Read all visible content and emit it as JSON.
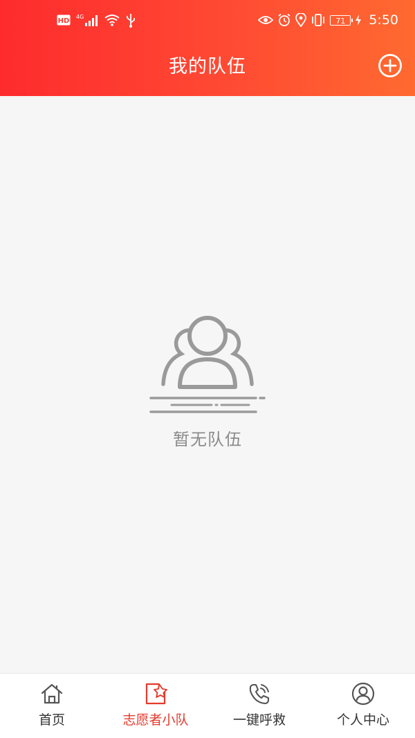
{
  "status_bar": {
    "network_badge": "HD",
    "network_type": "4G",
    "battery_level": "71",
    "time": "5:50"
  },
  "header": {
    "title": "我的队伍",
    "add_icon": "plus-circle-icon"
  },
  "empty_state": {
    "icon": "group-users-icon",
    "message": "暂无队伍"
  },
  "tabbar": {
    "active_color": "#e4392c",
    "items": [
      {
        "label": "首页",
        "icon": "home-icon"
      },
      {
        "label": "志愿者小队",
        "icon": "volunteer-star-icon",
        "active": true
      },
      {
        "label": "一键呼救",
        "icon": "phone-call-icon"
      },
      {
        "label": "个人中心",
        "icon": "user-icon"
      }
    ]
  },
  "colors": {
    "header_gradient_start": "#fe2b2d",
    "header_gradient_end": "#ff6a30",
    "background": "#f6f6f6"
  }
}
